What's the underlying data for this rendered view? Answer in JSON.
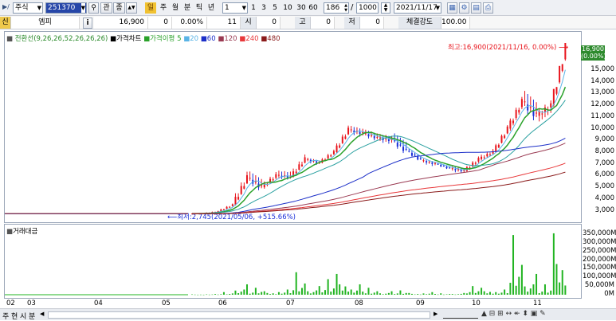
{
  "toolbar": {
    "market_type": "주식",
    "stock_code": "251370",
    "btn_related": "관",
    "btn_order": "종",
    "period_badge": "일",
    "periods": [
      "주",
      "월",
      "분",
      "틱",
      "년"
    ],
    "interval_value": "1",
    "intervals": [
      "1",
      "3",
      "5",
      "10",
      "30",
      "60"
    ],
    "bar_count": "186",
    "bar_total": "1000",
    "date": "2021/11/17"
  },
  "quote": {
    "badge": "신",
    "name": "엠피",
    "info_btn": "i",
    "price": "16,900",
    "change": "0",
    "change_pct": "0.00%",
    "volume": "11",
    "open_label": "시",
    "open": "0",
    "high_label": "고",
    "high": "0",
    "low_label": "저",
    "low": "0",
    "strength_label": "체결강도",
    "strength": "100.00"
  },
  "price_panel": {
    "legend": [
      "전환선(9,26,26,52,26,26,26)",
      "가격차트",
      "가격이평 5",
      "20",
      "60",
      "120",
      "240",
      "480"
    ],
    "max_label": "최고:16,900(2021/11/16, 0.00%)",
    "min_label": "최저:2,745(2021/05/06, +515.66%)",
    "last_price": "16,900",
    "last_pct": "(0.00%)",
    "y_ticks": [
      "15,000",
      "14,000",
      "13,000",
      "12,000",
      "11,000",
      "10,000",
      "9,000",
      "8,000",
      "7,000",
      "6,000",
      "5,000",
      "4,000",
      "3,000"
    ]
  },
  "volume_panel": {
    "legend": "거래대금",
    "y_ticks": [
      "350,000M",
      "300,000M",
      "250,000M",
      "200,000M",
      "150,000M",
      "100,000M",
      "50,000M",
      "0M"
    ]
  },
  "x_axis": [
    "02",
    "03",
    "04",
    "05",
    "06",
    "07",
    "08",
    "09",
    "10",
    "11"
  ],
  "bottom_tabs": [
    "주",
    "현",
    "시",
    "분"
  ],
  "colors": {
    "up": "#e8141c",
    "down": "#1a2fd9",
    "ma5": "#2aa22a",
    "ma20": "#5ab4e6",
    "ma60": "#1c2fc8",
    "ma120": "#9a3a52",
    "ma240": "#e8383a",
    "ma480": "#8a1a1a",
    "volume": "#22b422"
  },
  "chart_data": {
    "type": "candlestick",
    "start_date": "2021-05-03",
    "ohlc_weekly_approx": [
      [
        2750,
        2800,
        2745,
        2780
      ],
      [
        2780,
        3000,
        2760,
        2950
      ],
      [
        2950,
        3600,
        2900,
        3500
      ],
      [
        3500,
        6300,
        3400,
        5800
      ],
      [
        5800,
        6700,
        4600,
        5000
      ],
      [
        5000,
        6300,
        4800,
        6000
      ],
      [
        6000,
        6600,
        5600,
        5900
      ],
      [
        5900,
        7800,
        5800,
        7400
      ],
      [
        7400,
        7600,
        6800,
        7100
      ],
      [
        7100,
        8200,
        7000,
        8000
      ],
      [
        8000,
        10200,
        7900,
        9900
      ],
      [
        9900,
        10400,
        9200,
        9600
      ],
      [
        9600,
        10100,
        8900,
        9200
      ],
      [
        9200,
        9700,
        8600,
        9000
      ],
      [
        9000,
        10000,
        7800,
        8100
      ],
      [
        8100,
        8400,
        7200,
        7300
      ],
      [
        7300,
        7500,
        6700,
        7000
      ],
      [
        7000,
        7200,
        6500,
        6600
      ],
      [
        6600,
        6900,
        6100,
        6400
      ],
      [
        6400,
        7600,
        6200,
        7400
      ],
      [
        7400,
        8300,
        7200,
        8000
      ],
      [
        8000,
        10200,
        7900,
        10000
      ],
      [
        10000,
        12600,
        9700,
        12300
      ],
      [
        12300,
        13800,
        10500,
        11100
      ],
      [
        11100,
        12400,
        10300,
        12000
      ],
      [
        12000,
        16900,
        11800,
        16900
      ]
    ],
    "volume_weekly_approx_M": [
      2000,
      4000,
      15000,
      60000,
      40000,
      20000,
      30000,
      130000,
      50000,
      90000,
      120000,
      60000,
      40000,
      20000,
      25000,
      10000,
      15000,
      8000,
      10000,
      50000,
      40000,
      30000,
      345000,
      120000,
      60000,
      355000
    ],
    "ylim": [
      2700,
      16900
    ],
    "volume_ylim": [
      0,
      350000
    ]
  }
}
